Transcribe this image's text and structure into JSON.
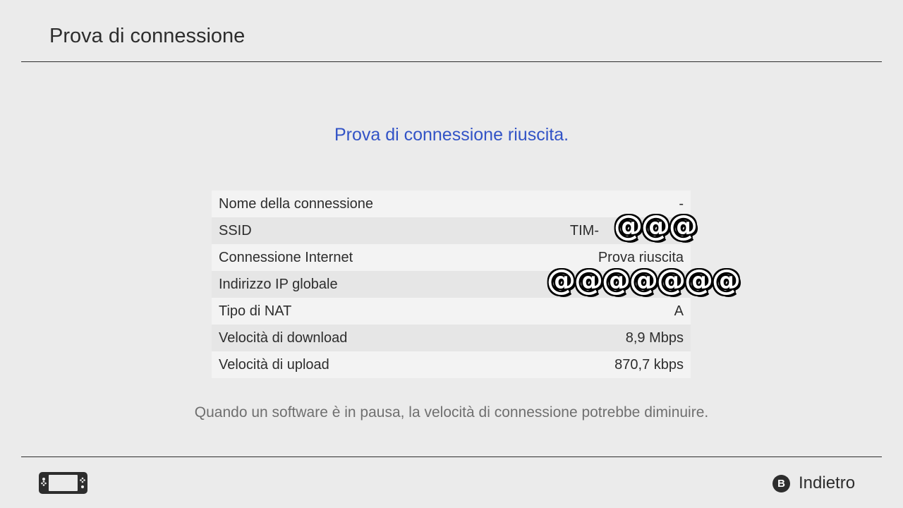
{
  "header": {
    "title": "Prova di connessione"
  },
  "result": {
    "message": "Prova di connessione riuscita."
  },
  "connection_info": {
    "rows": [
      {
        "label": "Nome della connessione",
        "value": "-"
      },
      {
        "label": "SSID",
        "value": "TIM-"
      },
      {
        "label": "Connessione Internet",
        "value": "Prova riuscita"
      },
      {
        "label": "Indirizzo IP globale",
        "value": ""
      },
      {
        "label": "Tipo di NAT",
        "value": "A"
      },
      {
        "label": "Velocità di download",
        "value": "8,9 Mbps"
      },
      {
        "label": "Velocità di upload",
        "value": "870,7 kbps"
      }
    ]
  },
  "redactions": {
    "ssid_overlay": "@@@",
    "ip_overlay": "@@@@@@@"
  },
  "note": {
    "text": "Quando un software è in pausa, la velocità di connessione potrebbe diminuire."
  },
  "footer": {
    "console_icon": "handheld-console-icon",
    "back_button_key": "B",
    "back_label": "Indietro"
  },
  "colors": {
    "background": "#ebebeb",
    "accent": "#3253c6",
    "text": "#2d2d2d",
    "note_text": "#6f6f6f"
  }
}
